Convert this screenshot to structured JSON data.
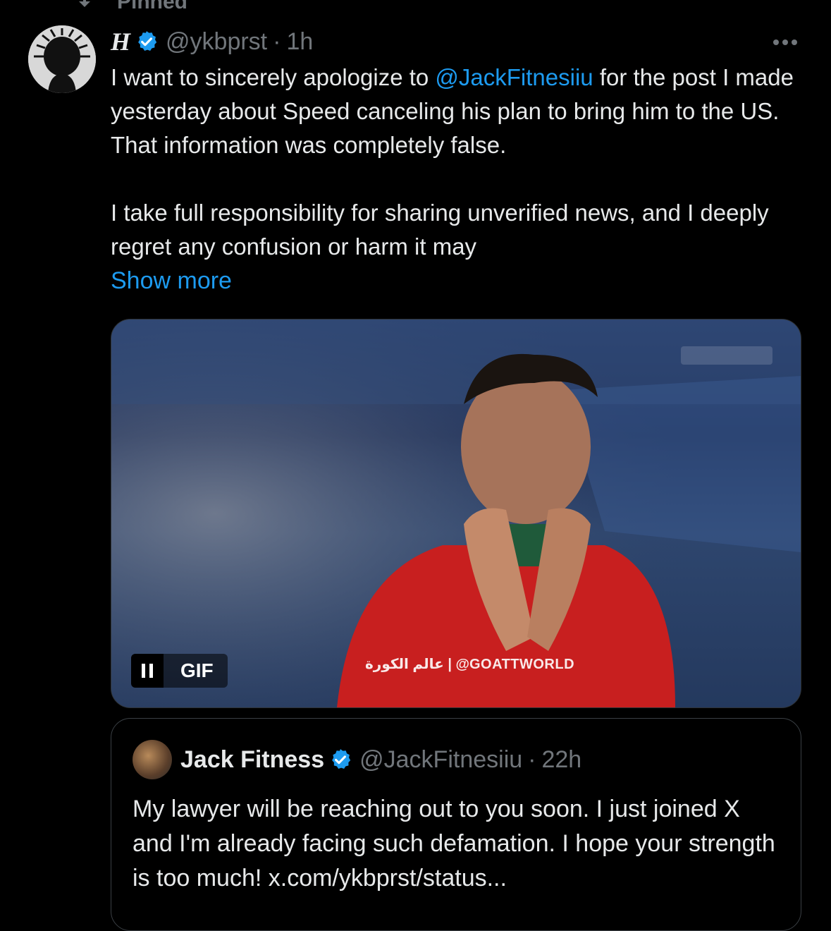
{
  "pinned": {
    "label": "Pinned",
    "icon": "pin-icon"
  },
  "tweet": {
    "display_name": "H",
    "verified_icon": "verified-badge-icon",
    "handle": "@ykbprst",
    "separator": "·",
    "time": "1h",
    "more_icon": "more-icon",
    "text_part1": "I want to sincerely apologize to ",
    "mention": "@JackFitnesiiu",
    "text_part2": " for the post I made yesterday about Speed canceling his plan to bring him to the US. That information was completely false.",
    "paragraph2": "I take full responsibility for sharing unverified news, and I deeply regret any confusion or harm it may",
    "show_more": "Show more",
    "media": {
      "type": "gif",
      "gif_label": "GIF",
      "pause_icon": "pause-icon",
      "watermark": "عالم الكورة | @GOATTWORLD"
    }
  },
  "quote": {
    "display_name": "Jack Fitness",
    "verified_icon": "verified-badge-icon",
    "handle": "@JackFitnesiiu",
    "separator": "·",
    "time": "22h",
    "text": "My lawyer will be reaching out to you soon. I just joined X and I'm already facing such defamation. I hope your strength is too much! x.com/ykbprst/status..."
  },
  "colors": {
    "background": "#000000",
    "text": "#e7e9ea",
    "muted": "#71767b",
    "link": "#1d9bf0"
  }
}
